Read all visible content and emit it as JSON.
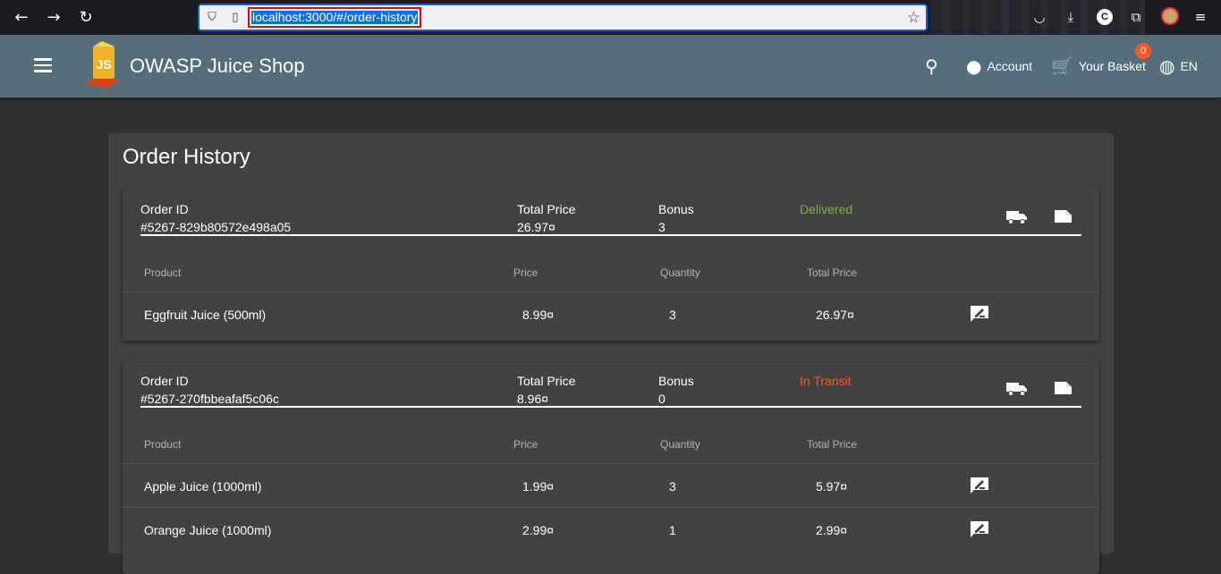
{
  "browser": {
    "url": "localhost:3000/#/order-history",
    "profile_letter": "C",
    "icons": [
      "back-icon",
      "forward-icon",
      "reload-icon",
      "shield-icon",
      "page-icon",
      "star-icon",
      "pocket-icon",
      "download-icon",
      "extensions-icon",
      "menu-icon"
    ]
  },
  "app": {
    "title": "OWASP Juice Shop",
    "account_label": "Account",
    "basket_label": "Your Basket",
    "basket_count": "0",
    "language": "EN",
    "toolbar_color": "#546e7a"
  },
  "page": {
    "title": "Order History"
  },
  "labels": {
    "order_id": "Order ID",
    "total_price": "Total Price",
    "bonus": "Bonus",
    "col_product": "Product",
    "col_price": "Price",
    "col_quantity": "Quantity",
    "col_total_price": "Total Price"
  },
  "orders": [
    {
      "id": "#5267-829b80572e498a05",
      "total_price": "26.97¤",
      "bonus": "3",
      "status": "Delivered",
      "status_color": "#7cb342",
      "items": [
        {
          "product": "Eggfruit Juice (500ml)",
          "price": "8.99¤",
          "quantity": "3",
          "total": "26.97¤"
        }
      ]
    },
    {
      "id": "#5267-270fbbeafaf5c06c",
      "total_price": "8.96¤",
      "bonus": "0",
      "status": "In Transit",
      "status_color": "#ff5722",
      "items": [
        {
          "product": "Apple Juice (1000ml)",
          "price": "1.99¤",
          "quantity": "3",
          "total": "5.97¤"
        },
        {
          "product": "Orange Juice (1000ml)",
          "price": "2.99¤",
          "quantity": "1",
          "total": "2.99¤"
        }
      ]
    }
  ]
}
